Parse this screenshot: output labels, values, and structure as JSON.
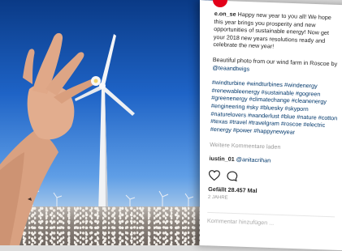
{
  "post": {
    "username": "e.on_se",
    "caption_line1": "Happy new year to you all! We hope this year brings you prosperity and new opportunities of sustainable energy! Now get your 2018 new years resolutions ready and celebrate the new year!",
    "credit_text": "Beautiful photo from our wind farm in Roscoe by",
    "credit_user": "@teaandtwigs",
    "hashtags": "#windturbine #windturbines #windenergy #renewableenergy #sustainable #gogreen #greenenergy #climatechange #cleanenergy #engineering #sky #bluesky #skyporn #naturelovers #wanderlust #blue #nature #cotton #texas #travel #travelgram #roscoe #electric #energy #power #happynewyear"
  },
  "comments": {
    "more_label": "Weitere Kommentare laden",
    "author": "iustin_01",
    "mention": "@anitacrihan"
  },
  "footer": {
    "likes": "Gefällt 28.457 Mal",
    "time": "2 JAHRE",
    "add_comment_placeholder": "Kommentar hinzufügen ..."
  },
  "icons": {
    "like": "heart-icon",
    "comment": "comment-bubble-icon"
  },
  "colors": {
    "brand": "#e2001a",
    "link": "#00376b",
    "sky": "#1e63c6"
  }
}
